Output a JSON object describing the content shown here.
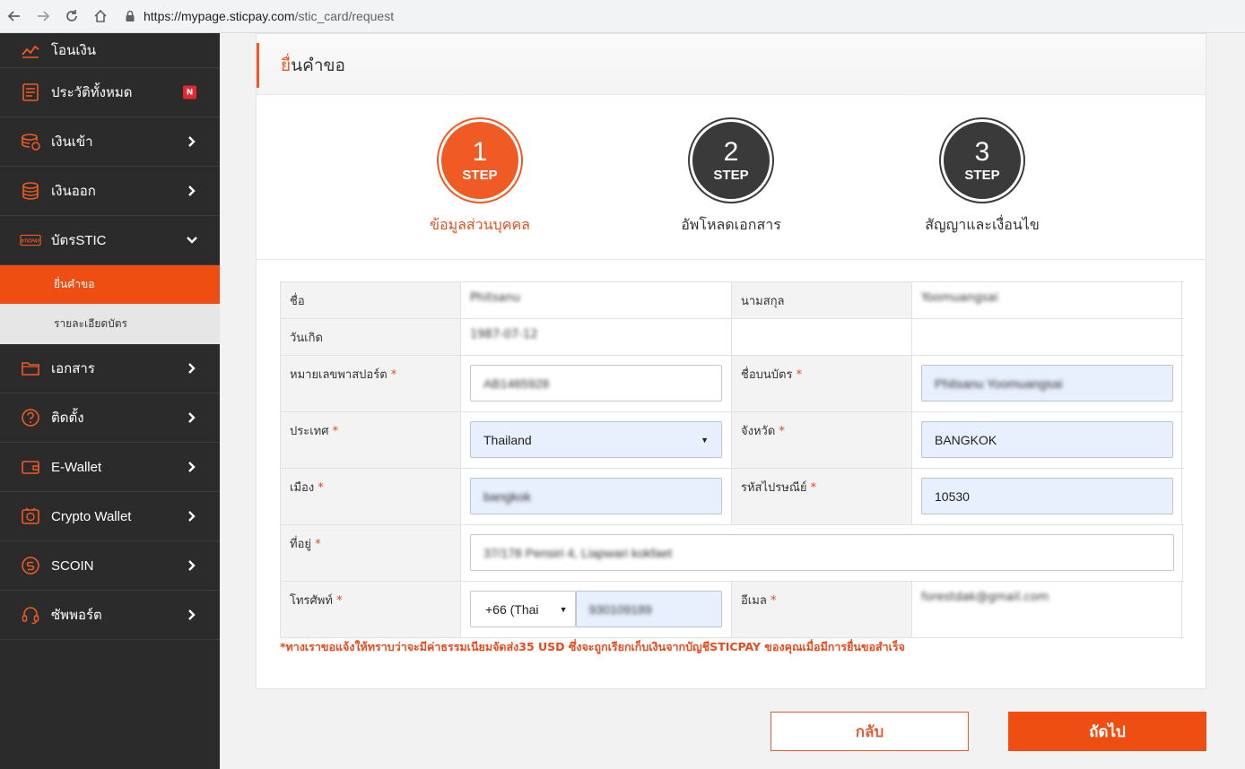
{
  "browser": {
    "url_host": "https://mypage.sticpay.com",
    "url_path": "/stic_card/request"
  },
  "sidebar": {
    "items": [
      {
        "label": "โอนเงิน",
        "icon": "transfer-icon"
      },
      {
        "label": "ประวัติทั้งหมด",
        "icon": "history-icon",
        "badge": "N"
      },
      {
        "label": "เงินเข้า",
        "icon": "deposit-icon"
      },
      {
        "label": "เงินออก",
        "icon": "withdraw-icon"
      },
      {
        "label": "บัตรSTIC",
        "icon": "card-icon"
      },
      {
        "label": "เอกสาร",
        "icon": "folder-icon"
      },
      {
        "label": "ติดตั้ง",
        "icon": "question-icon"
      },
      {
        "label": "E-Wallet",
        "icon": "wallet-icon"
      },
      {
        "label": "Crypto Wallet",
        "icon": "crypto-icon"
      },
      {
        "label": "SCOIN",
        "icon": "scoin-icon"
      },
      {
        "label": "ซัพพอร์ต",
        "icon": "headset-icon"
      }
    ],
    "card_icon_text": "STICPAY",
    "subitems": [
      {
        "label": "ยื่นคำขอ"
      },
      {
        "label": "รายละเอียดบัตร"
      }
    ]
  },
  "page": {
    "title_prefix": "ยื่",
    "title_rest": "นคำขอ"
  },
  "steps": [
    {
      "num": "1",
      "word": "STEP",
      "label": "ข้อมูลส่วนบุคคล",
      "state": "active"
    },
    {
      "num": "2",
      "word": "STEP",
      "label": "อัพโหลดเอกสาร",
      "state": "pending"
    },
    {
      "num": "3",
      "word": "STEP",
      "label": "สัญญาและเงื่อนไข",
      "state": "pending"
    }
  ],
  "form": {
    "first_name_label": "ชื่อ",
    "first_name_value": "Phitsanu",
    "last_name_label": "นามสกุล",
    "last_name_value": "Yoomuangsai",
    "birthdate_label": "วันเกิด",
    "birthdate_value": "1987-07-12",
    "passport_label": "หมายเลขพาสปอร์ต",
    "passport_value": "AB1465928",
    "card_name_label": "ชื่อบนบัตร",
    "card_name_value": "Phitsanu Yoomuangsai",
    "country_label": "ประเทศ",
    "country_value": "Thailand",
    "province_label": "จังหวัด",
    "province_value": "BANGKOK",
    "city_label": "เมือง",
    "city_value": "bangkok",
    "postal_label": "รหัสไปรษณีย์",
    "postal_value": "10530",
    "address_label": "ที่อยู่",
    "address_value": "37/178 Pensiri 4, Liapwari kokfaet",
    "phone_label": "โทรศัพท์",
    "phone_code_value": "+66 (Thai",
    "phone_value": "930109189",
    "email_label": "อีเมล",
    "email_value": "forestdak@gmail.com",
    "required_mark": "*"
  },
  "note": "*ทางเราขอแจ้งให้ทราบว่าจะมีค่าธรรมเนียมจัดส่ง35 USD ซึ่งจะถูกเรียกเก็บเงินจากบัญชีSTICPAY ของคุณเมื่อมีการยื่นขอสำเร็จ",
  "buttons": {
    "back": "กลับ",
    "next": "ถัดไป"
  },
  "colors": {
    "accent": "#ef4e12",
    "sidebar_bg": "#2b2b2b"
  }
}
